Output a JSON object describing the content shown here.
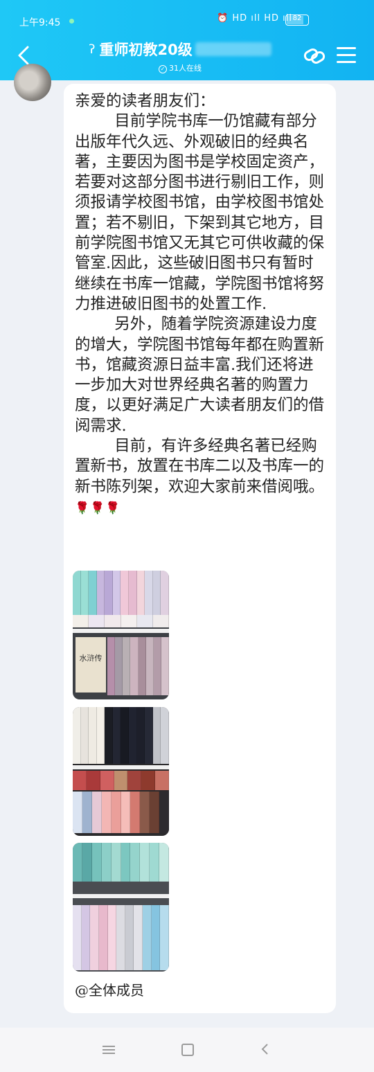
{
  "status_bar": {
    "time": "上午9:45",
    "indicators": "⏰ HD ıll HD ıll",
    "battery": "82",
    "battery_level_percent": 82
  },
  "header": {
    "title": "重师初教20级",
    "online_status": "31人在线",
    "back_icon": "chevron-left-icon",
    "share_icon": "share-link-icon",
    "menu_icon": "hamburger-menu-icon",
    "ear_icon": "ear-icon",
    "accent_color": "#1fc8f6"
  },
  "message": {
    "text": "亲爱的读者朋友们：\n        目前学院书库一仍馆藏有部分出版年代久远、外观破旧的经典名著，主要因为图书是学校固定资产，若要对这部分图书进行剔旧工作，则须报请学校图书馆，由学校图书馆处置；若不剔旧，下架到其它地方，目前学院图书馆又无其它可供收藏的保管室.因此，这些破旧图书只有暂时继续在书库一馆藏，学院图书馆将努力推进破旧图书的处置工作.\n        另外，随着学院资源建设力度的增大，学院图书馆每年都在购置新书，馆藏资源日益丰富.我们还将进一步加大对世界经典名著的购置力度，以更好满足广大读者朋友们的借阅需求.\n        目前，有许多经典名著已经购置新书，放置在书库二以及书库一的新书陈列架，欢迎大家前来借阅哦。",
    "roses": "🌹🌹🌹",
    "images": [
      "bookshelf-photo-1",
      "bookshelf-photo-2",
      "bookshelf-photo-3"
    ],
    "book_label": "水浒传",
    "mention": "@全体成员"
  },
  "navbar": {
    "icons": [
      "menu-icon",
      "home-icon",
      "back-icon"
    ]
  }
}
